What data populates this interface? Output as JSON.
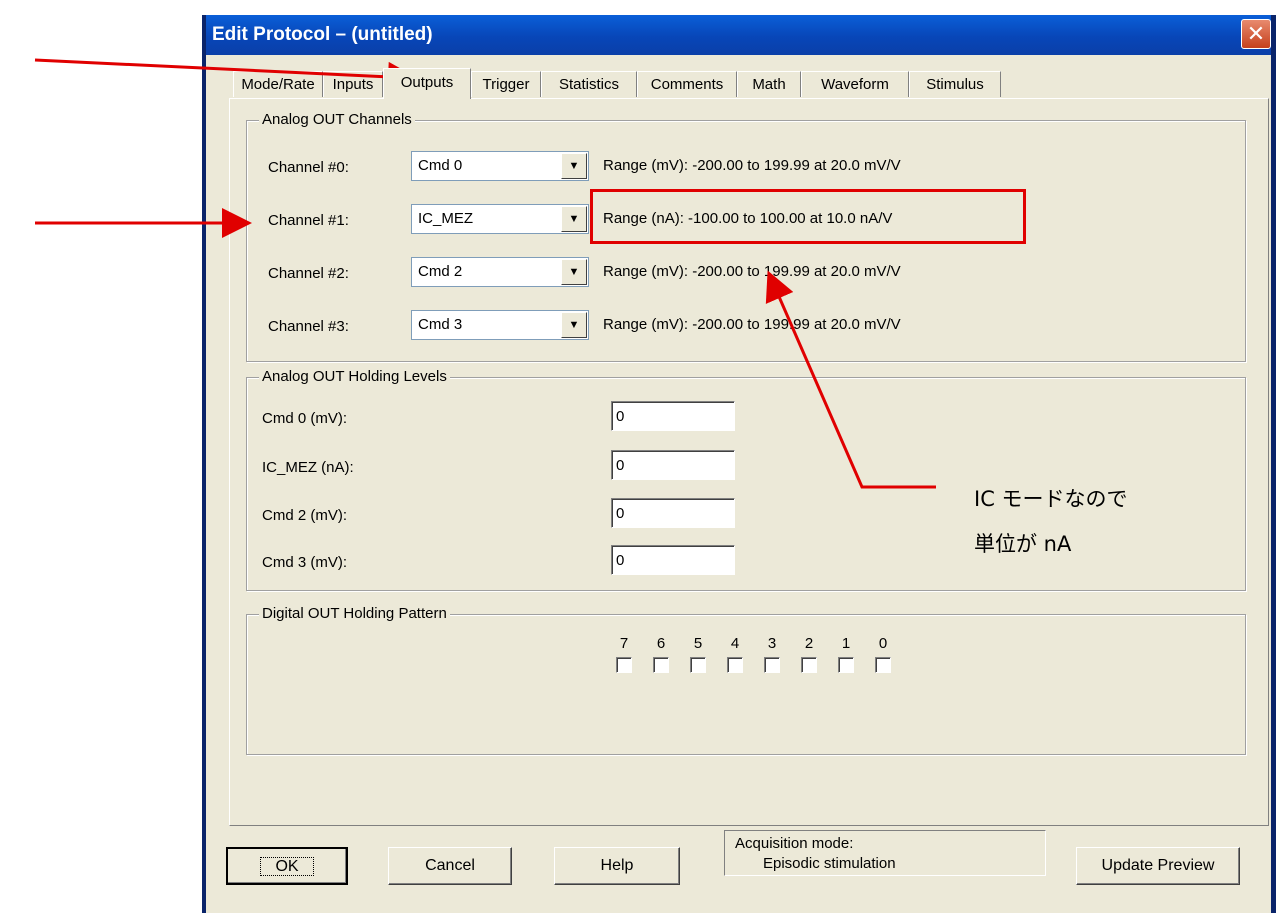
{
  "window": {
    "title": "Edit Protocol – (untitled)",
    "close_glyph": "✕"
  },
  "tabs": [
    "Mode/Rate",
    "Inputs",
    "Outputs",
    "Trigger",
    "Statistics",
    "Comments",
    "Math",
    "Waveform",
    "Stimulus"
  ],
  "selected_tab": "Outputs",
  "analog_out_channels": {
    "title": "Analog OUT Channels",
    "channels": [
      {
        "label": "Channel #0:",
        "value": "Cmd 0",
        "range": "Range (mV): -200.00 to 199.99 at 20.0 mV/V"
      },
      {
        "label": "Channel #1:",
        "value": "IC_MEZ",
        "range": "Range (nA): -100.00 to 100.00 at 10.0 nA/V"
      },
      {
        "label": "Channel #2:",
        "value": "Cmd 2",
        "range": "Range (mV): -200.00 to 199.99 at 20.0 mV/V"
      },
      {
        "label": "Channel #3:",
        "value": "Cmd 3",
        "range": "Range (mV): -200.00 to 199.99 at 20.0 mV/V"
      }
    ]
  },
  "holding_levels": {
    "title": "Analog OUT Holding Levels",
    "items": [
      {
        "label": "Cmd 0 (mV):",
        "value": "0"
      },
      {
        "label": "IC_MEZ (nA):",
        "value": "0"
      },
      {
        "label": "Cmd 2 (mV):",
        "value": "0"
      },
      {
        "label": "Cmd 3 (mV):",
        "value": "0"
      }
    ]
  },
  "digital_out": {
    "title": "Digital OUT Holding Pattern",
    "bits": [
      "7",
      "6",
      "5",
      "4",
      "3",
      "2",
      "1",
      "0"
    ]
  },
  "buttons": {
    "ok": "OK",
    "cancel": "Cancel",
    "help": "Help",
    "update_preview": "Update Preview"
  },
  "acquisition": {
    "label": "Acquisition mode:",
    "value": "Episodic stimulation"
  },
  "annotation": {
    "line1": "IC モードなので",
    "line2": "単位が nA",
    "color": "#e00000"
  },
  "icons": {
    "dropdown": "dropdown-arrow-icon",
    "close": "close-icon"
  }
}
